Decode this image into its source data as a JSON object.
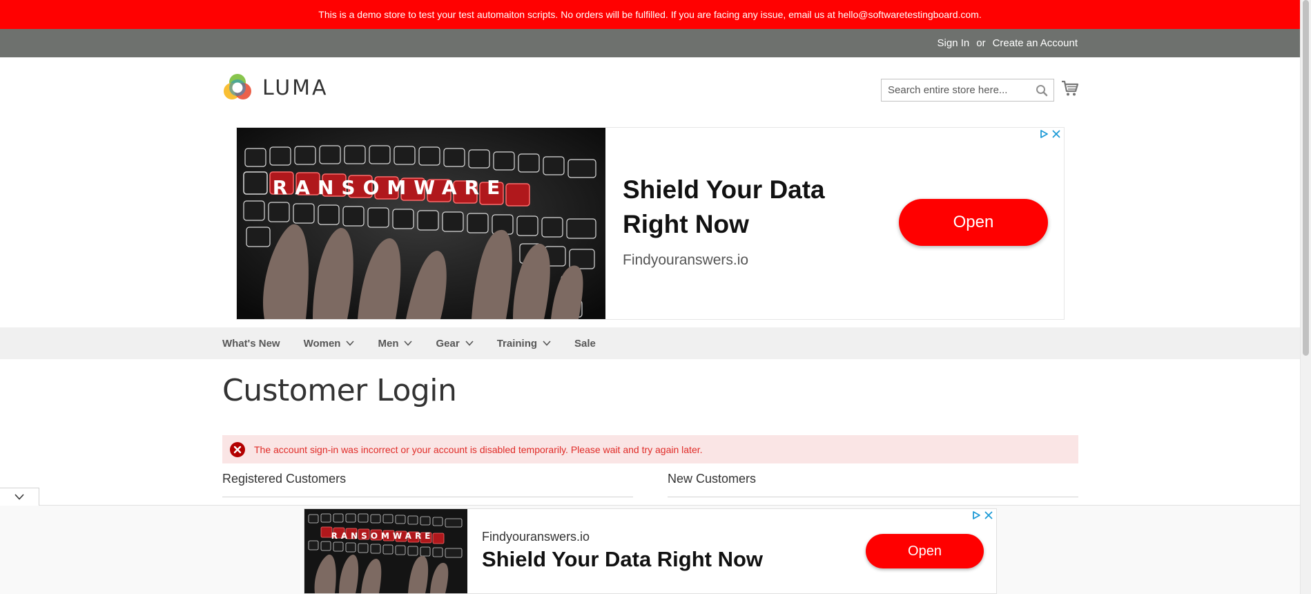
{
  "demo_notice": "This is a demo store to test your test automaiton scripts. No orders will be fulfilled. If you are facing any issue, email us at hello@softwaretestingboard.com.",
  "header": {
    "sign_in": "Sign In",
    "or": "or",
    "create_account": "Create an Account"
  },
  "logo": {
    "text": "LUMA"
  },
  "search": {
    "placeholder": "Search entire store here..."
  },
  "ad_top": {
    "headline": "Shield Your Data Right Now",
    "domain": "Findyouranswers.io",
    "button": "Open",
    "image_word": "RANSOMWARE"
  },
  "nav": {
    "items": [
      {
        "label": "What's New",
        "has_dropdown": false
      },
      {
        "label": "Women",
        "has_dropdown": true
      },
      {
        "label": "Men",
        "has_dropdown": true
      },
      {
        "label": "Gear",
        "has_dropdown": true
      },
      {
        "label": "Training",
        "has_dropdown": true
      },
      {
        "label": "Sale",
        "has_dropdown": false
      }
    ]
  },
  "page": {
    "title": "Customer Login",
    "error": "The account sign-in was incorrect or your account is disabled temporarily. Please wait and try again later.",
    "registered_title": "Registered Customers",
    "new_title": "New Customers"
  },
  "ad_bottom": {
    "domain": "Findyouranswers.io",
    "headline": "Shield Your Data Right Now",
    "button": "Open",
    "image_word": "RANSOMWARE"
  },
  "colors": {
    "notice_bg": "#ff0101",
    "header_bg": "#6e716e",
    "nav_bg": "#f0f0f0",
    "error_bg": "#fae5e5",
    "error_text": "#e02b27",
    "ad_button": "#ff0000"
  }
}
